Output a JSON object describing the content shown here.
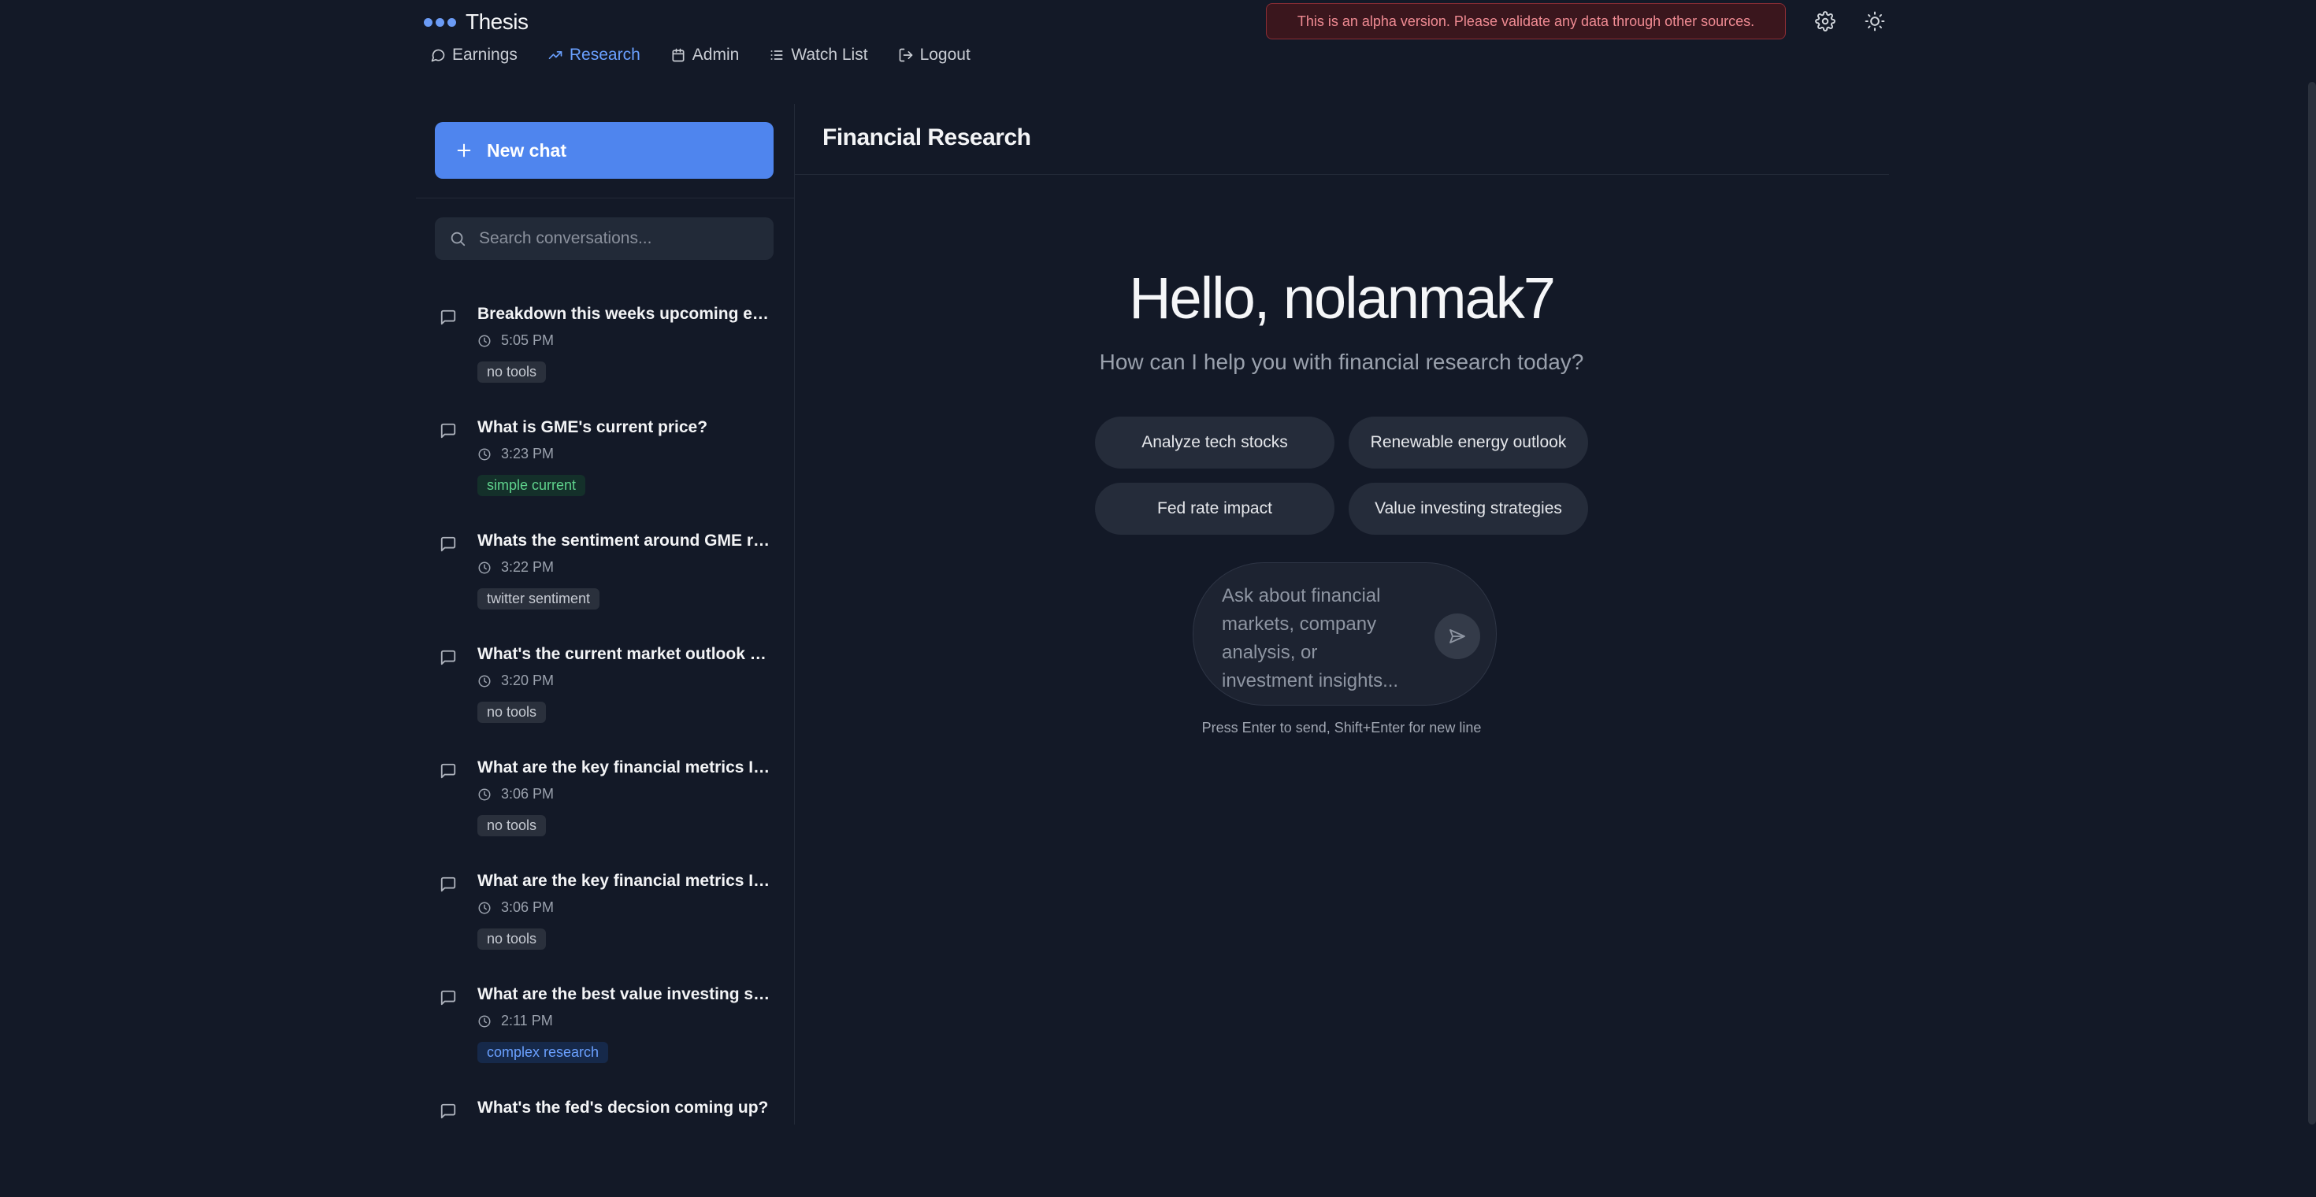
{
  "app": {
    "title": "Thesis",
    "brand_color": "#6b9bf5"
  },
  "nav": {
    "items": [
      {
        "label": "Earnings",
        "icon": "message-circle-icon"
      },
      {
        "label": "Research",
        "icon": "trending-up-icon",
        "active": true
      },
      {
        "label": "Admin",
        "icon": "calendar-icon"
      },
      {
        "label": "Watch List",
        "icon": "list-icon"
      },
      {
        "label": "Logout",
        "icon": "logout-icon"
      }
    ]
  },
  "banner": {
    "text": "This is an alpha version. Please validate any data through other sources."
  },
  "sidebar": {
    "new_chat_label": "New chat",
    "search_placeholder": "Search conversations...",
    "conversations": [
      {
        "title": "Breakdown this weeks upcoming earnings and provide insights",
        "time": "5:05 PM",
        "tag": "no tools"
      },
      {
        "title": "What is GME's current price?",
        "time": "3:23 PM",
        "tag": "simple current"
      },
      {
        "title": "Whats the sentiment around GME right now?",
        "time": "3:22 PM",
        "tag": "twitter sentiment"
      },
      {
        "title": "What's the current market outlook for tech stocks?",
        "time": "3:20 PM",
        "tag": "no tools"
      },
      {
        "title": "What are the key financial metrics I should look at?",
        "time": "3:06 PM",
        "tag": "no tools"
      },
      {
        "title": "What are the key financial metrics I should look at?",
        "time": "3:06 PM",
        "tag": "no tools"
      },
      {
        "title": "What are the best value investing strategies?",
        "time": "2:11 PM",
        "tag": "complex research"
      },
      {
        "title": "What's the fed's decsion coming up?",
        "time": "",
        "tag": ""
      }
    ]
  },
  "main": {
    "title": "Financial Research",
    "greeting": "Hello, nolanmak7",
    "subtitle": "How can I help you with financial research today?",
    "suggestions": [
      "Analyze tech stocks",
      "Renewable energy outlook",
      "Fed rate impact",
      "Value investing strategies"
    ],
    "composer_placeholder": "Ask about financial markets, company analysis, or investment insights...",
    "hint": "Press Enter to send, Shift+Enter for new line"
  }
}
